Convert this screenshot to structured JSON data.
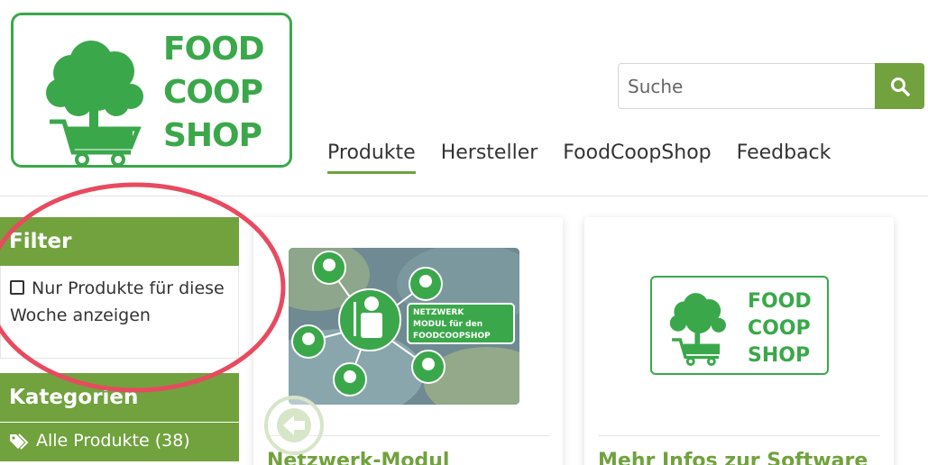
{
  "logo": {
    "lines": [
      "FOOD",
      "COOP",
      "SHOP"
    ],
    "color": "#3aa84a"
  },
  "search": {
    "placeholder": "Suche",
    "button_icon": "search-icon"
  },
  "nav": {
    "items": [
      "Produkte",
      "Hersteller",
      "FoodCoopShop",
      "Feedback"
    ],
    "active": "Produkte"
  },
  "sidebar": {
    "filter_title": "Filter",
    "filter_option_label": "Nur Produkte für diese Woche anzeigen",
    "filter_option_checked": false,
    "categories_title": "Kategorien",
    "category_items": [
      {
        "label": "Alle Produkte (38)",
        "icon": "tags-icon"
      }
    ]
  },
  "products": [
    {
      "title": "Netzwerk-Modul",
      "image_text": [
        "NETZWERK",
        "MODUL für den",
        "FOODCOOPSHOP"
      ]
    },
    {
      "title": "Mehr Infos zur Software",
      "image_text": [
        "FOOD",
        "COOP",
        "SHOP"
      ]
    }
  ],
  "colors": {
    "accent": "#71a23e",
    "annotation": "#e84a5f"
  }
}
